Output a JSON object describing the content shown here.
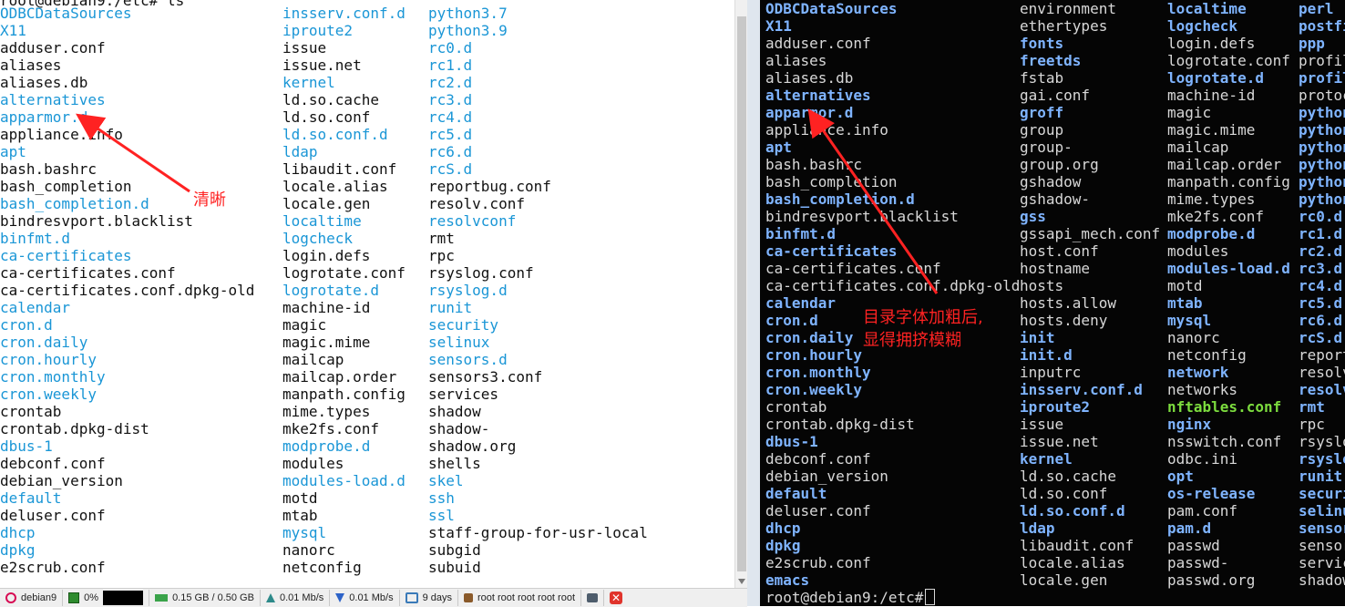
{
  "left_terminal": {
    "prompt_cut": "root@debian9:/etc# ls",
    "columns": [
      [
        {
          "name": "ODBCDataSources",
          "kind": "dir"
        },
        {
          "name": "X11",
          "kind": "dir"
        },
        {
          "name": "adduser.conf",
          "kind": "file"
        },
        {
          "name": "aliases",
          "kind": "file"
        },
        {
          "name": "aliases.db",
          "kind": "file"
        },
        {
          "name": "alternatives",
          "kind": "dir"
        },
        {
          "name": "apparmor.d",
          "kind": "dir"
        },
        {
          "name": "appliance.info",
          "kind": "file"
        },
        {
          "name": "apt",
          "kind": "dir"
        },
        {
          "name": "bash.bashrc",
          "kind": "file"
        },
        {
          "name": "bash_completion",
          "kind": "file"
        },
        {
          "name": "bash_completion.d",
          "kind": "dir"
        },
        {
          "name": "bindresvport.blacklist",
          "kind": "file"
        },
        {
          "name": "binfmt.d",
          "kind": "dir"
        },
        {
          "name": "ca-certificates",
          "kind": "dir"
        },
        {
          "name": "ca-certificates.conf",
          "kind": "file"
        },
        {
          "name": "ca-certificates.conf.dpkg-old",
          "kind": "file"
        },
        {
          "name": "calendar",
          "kind": "dir"
        },
        {
          "name": "cron.d",
          "kind": "dir"
        },
        {
          "name": "cron.daily",
          "kind": "dir"
        },
        {
          "name": "cron.hourly",
          "kind": "dir"
        },
        {
          "name": "cron.monthly",
          "kind": "dir"
        },
        {
          "name": "cron.weekly",
          "kind": "dir"
        },
        {
          "name": "crontab",
          "kind": "file"
        },
        {
          "name": "crontab.dpkg-dist",
          "kind": "file"
        },
        {
          "name": "dbus-1",
          "kind": "dir"
        },
        {
          "name": "debconf.conf",
          "kind": "file"
        },
        {
          "name": "debian_version",
          "kind": "file"
        },
        {
          "name": "default",
          "kind": "dir"
        },
        {
          "name": "deluser.conf",
          "kind": "file"
        },
        {
          "name": "dhcp",
          "kind": "dir"
        },
        {
          "name": "dpkg",
          "kind": "dir"
        },
        {
          "name": "e2scrub.conf",
          "kind": "file"
        }
      ],
      [
        {
          "name": "insserv.conf.d",
          "kind": "dir"
        },
        {
          "name": "iproute2",
          "kind": "dir"
        },
        {
          "name": "issue",
          "kind": "file"
        },
        {
          "name": "issue.net",
          "kind": "file"
        },
        {
          "name": "kernel",
          "kind": "dir"
        },
        {
          "name": "ld.so.cache",
          "kind": "file"
        },
        {
          "name": "ld.so.conf",
          "kind": "file"
        },
        {
          "name": "ld.so.conf.d",
          "kind": "dir"
        },
        {
          "name": "ldap",
          "kind": "dir"
        },
        {
          "name": "libaudit.conf",
          "kind": "file"
        },
        {
          "name": "locale.alias",
          "kind": "file"
        },
        {
          "name": "locale.gen",
          "kind": "file"
        },
        {
          "name": "localtime",
          "kind": "dir"
        },
        {
          "name": "logcheck",
          "kind": "dir"
        },
        {
          "name": "login.defs",
          "kind": "file"
        },
        {
          "name": "logrotate.conf",
          "kind": "file"
        },
        {
          "name": "logrotate.d",
          "kind": "dir"
        },
        {
          "name": "machine-id",
          "kind": "file"
        },
        {
          "name": "magic",
          "kind": "file"
        },
        {
          "name": "magic.mime",
          "kind": "file"
        },
        {
          "name": "mailcap",
          "kind": "file"
        },
        {
          "name": "mailcap.order",
          "kind": "file"
        },
        {
          "name": "manpath.config",
          "kind": "file"
        },
        {
          "name": "mime.types",
          "kind": "file"
        },
        {
          "name": "mke2fs.conf",
          "kind": "file"
        },
        {
          "name": "modprobe.d",
          "kind": "dir"
        },
        {
          "name": "modules",
          "kind": "file"
        },
        {
          "name": "modules-load.d",
          "kind": "dir"
        },
        {
          "name": "motd",
          "kind": "file"
        },
        {
          "name": "mtab",
          "kind": "file"
        },
        {
          "name": "mysql",
          "kind": "dir"
        },
        {
          "name": "nanorc",
          "kind": "file"
        },
        {
          "name": "netconfig",
          "kind": "file"
        }
      ],
      [
        {
          "name": "python3.7",
          "kind": "dir"
        },
        {
          "name": "python3.9",
          "kind": "dir"
        },
        {
          "name": "rc0.d",
          "kind": "dir"
        },
        {
          "name": "rc1.d",
          "kind": "dir"
        },
        {
          "name": "rc2.d",
          "kind": "dir"
        },
        {
          "name": "rc3.d",
          "kind": "dir"
        },
        {
          "name": "rc4.d",
          "kind": "dir"
        },
        {
          "name": "rc5.d",
          "kind": "dir"
        },
        {
          "name": "rc6.d",
          "kind": "dir"
        },
        {
          "name": "rcS.d",
          "kind": "dir"
        },
        {
          "name": "reportbug.conf",
          "kind": "file"
        },
        {
          "name": "resolv.conf",
          "kind": "file"
        },
        {
          "name": "resolvconf",
          "kind": "dir"
        },
        {
          "name": "rmt",
          "kind": "file"
        },
        {
          "name": "rpc",
          "kind": "file"
        },
        {
          "name": "rsyslog.conf",
          "kind": "file"
        },
        {
          "name": "rsyslog.d",
          "kind": "dir"
        },
        {
          "name": "runit",
          "kind": "dir"
        },
        {
          "name": "security",
          "kind": "dir"
        },
        {
          "name": "selinux",
          "kind": "dir"
        },
        {
          "name": "sensors.d",
          "kind": "dir"
        },
        {
          "name": "sensors3.conf",
          "kind": "file"
        },
        {
          "name": "services",
          "kind": "file"
        },
        {
          "name": "shadow",
          "kind": "file"
        },
        {
          "name": "shadow-",
          "kind": "file"
        },
        {
          "name": "shadow.org",
          "kind": "file"
        },
        {
          "name": "shells",
          "kind": "file"
        },
        {
          "name": "skel",
          "kind": "dir"
        },
        {
          "name": "ssh",
          "kind": "dir"
        },
        {
          "name": "ssl",
          "kind": "dir"
        },
        {
          "name": "staff-group-for-usr-local",
          "kind": "file"
        },
        {
          "name": "subgid",
          "kind": "file"
        },
        {
          "name": "subuid",
          "kind": "file"
        }
      ]
    ]
  },
  "right_terminal": {
    "columns": [
      [
        {
          "name": "ODBCDataSources",
          "kind": "dir"
        },
        {
          "name": "X11",
          "kind": "dir"
        },
        {
          "name": "adduser.conf",
          "kind": "file"
        },
        {
          "name": "aliases",
          "kind": "file"
        },
        {
          "name": "aliases.db",
          "kind": "file"
        },
        {
          "name": "alternatives",
          "kind": "dir"
        },
        {
          "name": "apparmor.d",
          "kind": "dir"
        },
        {
          "name": "appliance.info",
          "kind": "file"
        },
        {
          "name": "apt",
          "kind": "dir"
        },
        {
          "name": "bash.bashrc",
          "kind": "file"
        },
        {
          "name": "bash_completion",
          "kind": "file"
        },
        {
          "name": "bash_completion.d",
          "kind": "dir"
        },
        {
          "name": "bindresvport.blacklist",
          "kind": "file"
        },
        {
          "name": "binfmt.d",
          "kind": "dir"
        },
        {
          "name": "ca-certificates",
          "kind": "dir"
        },
        {
          "name": "ca-certificates.conf",
          "kind": "file"
        },
        {
          "name": "ca-certificates.conf.dpkg-old",
          "kind": "file"
        },
        {
          "name": "calendar",
          "kind": "dir"
        },
        {
          "name": "cron.d",
          "kind": "dir"
        },
        {
          "name": "cron.daily",
          "kind": "dir"
        },
        {
          "name": "cron.hourly",
          "kind": "dir"
        },
        {
          "name": "cron.monthly",
          "kind": "dir"
        },
        {
          "name": "cron.weekly",
          "kind": "dir"
        },
        {
          "name": "crontab",
          "kind": "file"
        },
        {
          "name": "crontab.dpkg-dist",
          "kind": "file"
        },
        {
          "name": "dbus-1",
          "kind": "dir"
        },
        {
          "name": "debconf.conf",
          "kind": "file"
        },
        {
          "name": "debian_version",
          "kind": "file"
        },
        {
          "name": "default",
          "kind": "dir"
        },
        {
          "name": "deluser.conf",
          "kind": "file"
        },
        {
          "name": "dhcp",
          "kind": "dir"
        },
        {
          "name": "dpkg",
          "kind": "dir"
        },
        {
          "name": "e2scrub.conf",
          "kind": "file"
        },
        {
          "name": "emacs",
          "kind": "dir"
        }
      ],
      [
        {
          "name": "environment",
          "kind": "file"
        },
        {
          "name": "ethertypes",
          "kind": "file"
        },
        {
          "name": "fonts",
          "kind": "dir"
        },
        {
          "name": "freetds",
          "kind": "dir"
        },
        {
          "name": "fstab",
          "kind": "file"
        },
        {
          "name": "gai.conf",
          "kind": "file"
        },
        {
          "name": "groff",
          "kind": "dir"
        },
        {
          "name": "group",
          "kind": "file"
        },
        {
          "name": "group-",
          "kind": "file"
        },
        {
          "name": "group.org",
          "kind": "file"
        },
        {
          "name": "gshadow",
          "kind": "file"
        },
        {
          "name": "gshadow-",
          "kind": "file"
        },
        {
          "name": "gss",
          "kind": "dir"
        },
        {
          "name": "gssapi_mech.conf",
          "kind": "file"
        },
        {
          "name": "host.conf",
          "kind": "file"
        },
        {
          "name": "hostname",
          "kind": "file"
        },
        {
          "name": "hosts",
          "kind": "file"
        },
        {
          "name": "hosts.allow",
          "kind": "file"
        },
        {
          "name": "hosts.deny",
          "kind": "file"
        },
        {
          "name": "init",
          "kind": "dir"
        },
        {
          "name": "init.d",
          "kind": "dir"
        },
        {
          "name": "inputrc",
          "kind": "file"
        },
        {
          "name": "insserv.conf.d",
          "kind": "dir"
        },
        {
          "name": "iproute2",
          "kind": "dir"
        },
        {
          "name": "issue",
          "kind": "file"
        },
        {
          "name": "issue.net",
          "kind": "file"
        },
        {
          "name": "kernel",
          "kind": "dir"
        },
        {
          "name": "ld.so.cache",
          "kind": "file"
        },
        {
          "name": "ld.so.conf",
          "kind": "file"
        },
        {
          "name": "ld.so.conf.d",
          "kind": "dir"
        },
        {
          "name": "ldap",
          "kind": "dir"
        },
        {
          "name": "libaudit.conf",
          "kind": "file"
        },
        {
          "name": "locale.alias",
          "kind": "file"
        },
        {
          "name": "locale.gen",
          "kind": "file"
        }
      ],
      [
        {
          "name": "localtime",
          "kind": "dir"
        },
        {
          "name": "logcheck",
          "kind": "dir"
        },
        {
          "name": "login.defs",
          "kind": "file"
        },
        {
          "name": "logrotate.conf",
          "kind": "file"
        },
        {
          "name": "logrotate.d",
          "kind": "dir"
        },
        {
          "name": "machine-id",
          "kind": "file"
        },
        {
          "name": "magic",
          "kind": "file"
        },
        {
          "name": "magic.mime",
          "kind": "file"
        },
        {
          "name": "mailcap",
          "kind": "file"
        },
        {
          "name": "mailcap.order",
          "kind": "file"
        },
        {
          "name": "manpath.config",
          "kind": "file"
        },
        {
          "name": "mime.types",
          "kind": "file"
        },
        {
          "name": "mke2fs.conf",
          "kind": "file"
        },
        {
          "name": "modprobe.d",
          "kind": "dir"
        },
        {
          "name": "modules",
          "kind": "file"
        },
        {
          "name": "modules-load.d",
          "kind": "dir"
        },
        {
          "name": "motd",
          "kind": "file"
        },
        {
          "name": "mtab",
          "kind": "dir"
        },
        {
          "name": "mysql",
          "kind": "dir"
        },
        {
          "name": "nanorc",
          "kind": "file"
        },
        {
          "name": "netconfig",
          "kind": "file"
        },
        {
          "name": "network",
          "kind": "dir"
        },
        {
          "name": "networks",
          "kind": "file"
        },
        {
          "name": "nftables.conf",
          "kind": "exec"
        },
        {
          "name": "nginx",
          "kind": "dir"
        },
        {
          "name": "nsswitch.conf",
          "kind": "file"
        },
        {
          "name": "odbc.ini",
          "kind": "file"
        },
        {
          "name": "opt",
          "kind": "dir"
        },
        {
          "name": "os-release",
          "kind": "dir"
        },
        {
          "name": "pam.conf",
          "kind": "file"
        },
        {
          "name": "pam.d",
          "kind": "dir"
        },
        {
          "name": "passwd",
          "kind": "file"
        },
        {
          "name": "passwd-",
          "kind": "file"
        },
        {
          "name": "passwd.org",
          "kind": "file"
        }
      ],
      [
        {
          "name": "perl",
          "kind": "dir"
        },
        {
          "name": "postfi",
          "kind": "dir"
        },
        {
          "name": "ppp",
          "kind": "dir"
        },
        {
          "name": "profil",
          "kind": "file"
        },
        {
          "name": "profil",
          "kind": "dir"
        },
        {
          "name": "protoc",
          "kind": "file"
        },
        {
          "name": "python",
          "kind": "dir"
        },
        {
          "name": "python",
          "kind": "dir"
        },
        {
          "name": "python",
          "kind": "dir"
        },
        {
          "name": "python",
          "kind": "dir"
        },
        {
          "name": "python",
          "kind": "dir"
        },
        {
          "name": "python",
          "kind": "dir"
        },
        {
          "name": "rc0.d",
          "kind": "dir"
        },
        {
          "name": "rc1.d",
          "kind": "dir"
        },
        {
          "name": "rc2.d",
          "kind": "dir"
        },
        {
          "name": "rc3.d",
          "kind": "dir"
        },
        {
          "name": "rc4.d",
          "kind": "dir"
        },
        {
          "name": "rc5.d",
          "kind": "dir"
        },
        {
          "name": "rc6.d",
          "kind": "dir"
        },
        {
          "name": "rcS.d",
          "kind": "dir"
        },
        {
          "name": "report",
          "kind": "file"
        },
        {
          "name": "resolv",
          "kind": "file"
        },
        {
          "name": "resolv",
          "kind": "dir"
        },
        {
          "name": "rmt",
          "kind": "dir"
        },
        {
          "name": "rpc",
          "kind": "file"
        },
        {
          "name": "rsyslo",
          "kind": "file"
        },
        {
          "name": "rsyslo",
          "kind": "dir"
        },
        {
          "name": "runit",
          "kind": "dir"
        },
        {
          "name": "securi",
          "kind": "dir"
        },
        {
          "name": "selinu",
          "kind": "dir"
        },
        {
          "name": "sensor",
          "kind": "dir"
        },
        {
          "name": "sensor",
          "kind": "file"
        },
        {
          "name": "servic",
          "kind": "file"
        },
        {
          "name": "shadow",
          "kind": "file"
        }
      ]
    ],
    "prompt": "root@debian9:/etc#"
  },
  "statusbar": {
    "host": "debian9",
    "cpu": "0%",
    "memory": "0.15 GB / 0.50 GB",
    "upload": "0.01 Mb/s",
    "download": "0.01 Mb/s",
    "uptime": "9 days",
    "users": "root  root  root  root  root"
  },
  "annotations": {
    "left_label": "清晰",
    "right_label_line1": "目录字体加粗后,",
    "right_label_line2": "显得拥挤模糊"
  },
  "colors": {
    "left_dir": "#1a96d6",
    "right_dir": "#7fb4ff",
    "right_exec": "#7cdc3e",
    "annotation": "#ff2222"
  }
}
